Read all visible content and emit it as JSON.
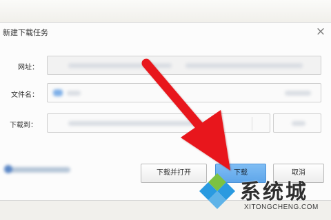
{
  "dialog": {
    "title": "新建下载任务",
    "close_symbol": "×"
  },
  "form": {
    "url_label": "网址：",
    "filename_label": "文件名：",
    "saveto_label": "下载到："
  },
  "buttons": {
    "download_open": "下载并打开",
    "download": "下载",
    "cancel": "取消"
  },
  "watermark": {
    "main": "系统城",
    "sub": "XITONGCHENG.COM"
  },
  "colors": {
    "arrow": "#e8161a",
    "primary_button": "#6aaeed",
    "logo_green": "#7cc242",
    "logo_blue": "#2a9ae0"
  }
}
